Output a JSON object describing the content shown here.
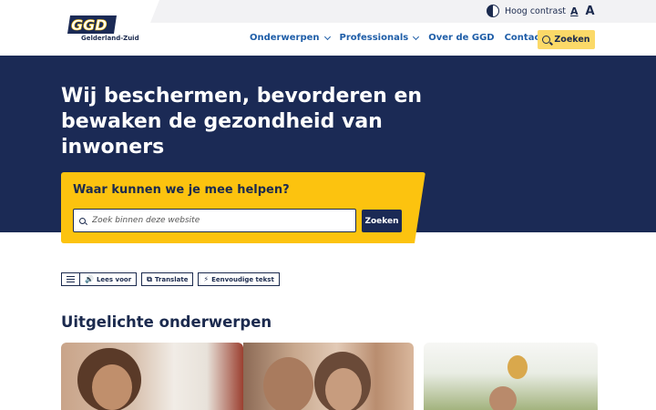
{
  "topbar": {
    "contrast_label": "Hoog contrast",
    "font_small": "A",
    "font_large": "A"
  },
  "header": {
    "logo_text": "GGD",
    "logo_subtitle": "Gelderland-Zuid",
    "nav": [
      {
        "label": "Onderwerpen",
        "has_dropdown": true
      },
      {
        "label": "Professionals",
        "has_dropdown": true
      },
      {
        "label": "Over de GGD",
        "has_dropdown": false
      },
      {
        "label": "Contact",
        "has_dropdown": false
      }
    ],
    "search_label": "Zoeken"
  },
  "hero": {
    "title": "Wij beschermen, bevorderen en bewaken de gezondheid van inwoners",
    "help_title": "Waar kunnen we je mee helpen?",
    "search_placeholder": "Zoek binnen deze website",
    "search_button": "Zoeken"
  },
  "tools": {
    "read_aloud": "Lees voor",
    "translate": "Translate",
    "simple_text": "Eenvoudige tekst"
  },
  "featured": {
    "title": "Uitgelichte onderwerpen"
  },
  "colors": {
    "navy": "#1b2a55",
    "yellow": "#fcc30f",
    "link_blue": "#1f5ea8",
    "search_yellow": "#fbd968"
  }
}
